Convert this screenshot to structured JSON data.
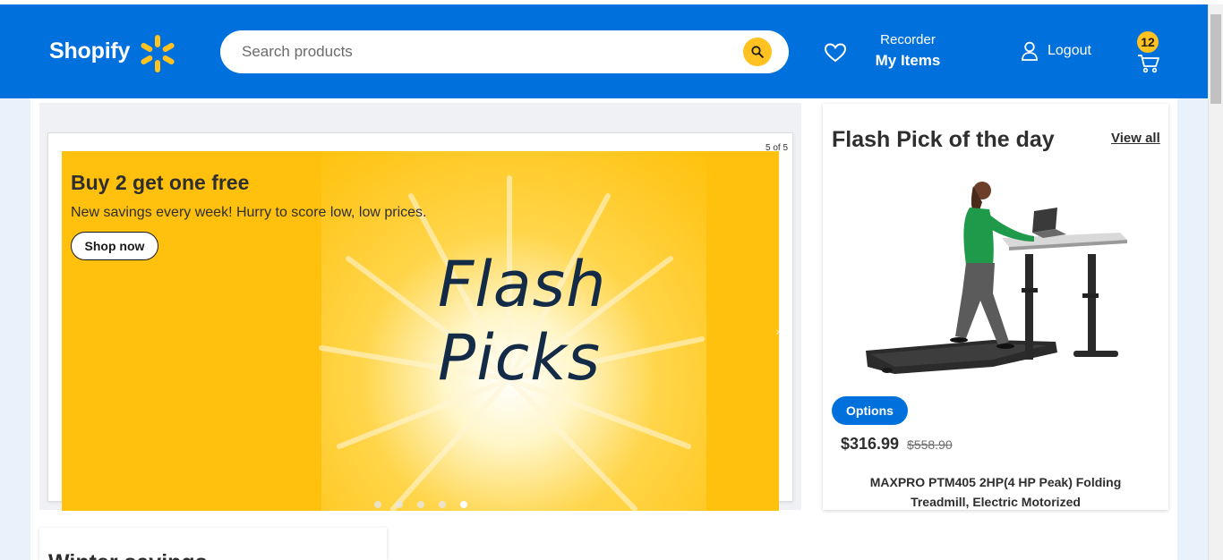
{
  "header": {
    "logo_text": "Shopify",
    "search_placeholder": "Search products",
    "reorder_line1": "Recorder",
    "reorder_line2": "My Items",
    "logout_label": "Logout",
    "cart_count": "12",
    "brand_color": "#0071dc",
    "accent_color": "#ffc220"
  },
  "hero": {
    "slide_counter": "5 of 5",
    "title": "Buy 2 get one free",
    "subtitle": "New savings every week! Hurry to score low, low prices.",
    "cta_label": "Shop now",
    "banner_line1": "Flash",
    "banner_line2": "Picks",
    "dots": 5,
    "active_dot": 5
  },
  "flash_pick": {
    "title": "Flash Pick of the day",
    "view_all_label": "View all",
    "options_label": "Options",
    "price": "$316.99",
    "old_price": "$558.90",
    "product_name": "MAXPRO PTM405 2HP(4 HP Peak) Folding Treadmill, Electric Motorized"
  },
  "winter": {
    "title": "Winter savings"
  },
  "icons": {
    "spark": "spark-icon",
    "search": "search-icon",
    "heart": "heart-icon",
    "user": "user-icon",
    "cart": "cart-icon"
  }
}
